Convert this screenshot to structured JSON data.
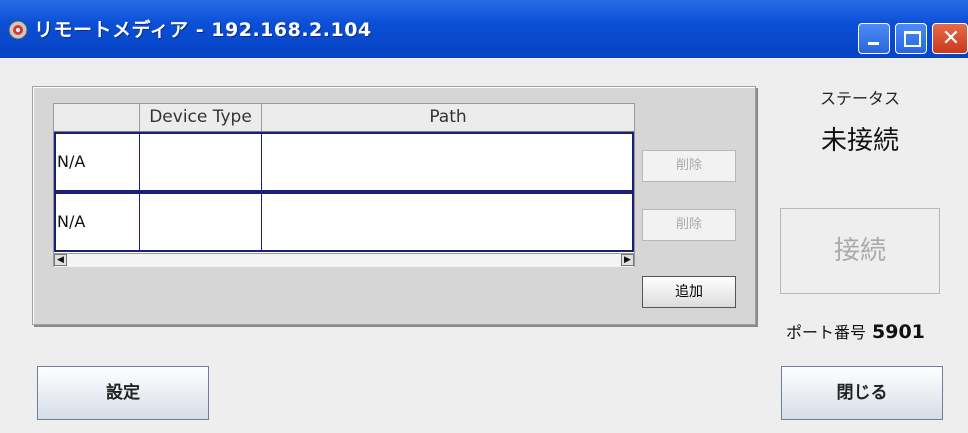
{
  "window": {
    "title": "リモートメディア - 192.168.2.104",
    "app_icon": "remote-media-app-icon",
    "controls": {
      "minimize": "minimize-icon",
      "maximize": "maximize-icon",
      "close_glyph": "✕"
    }
  },
  "table": {
    "columns": [
      "",
      "Device Type",
      "Path"
    ],
    "rows": [
      {
        "id": "N/A",
        "device_type": "",
        "path": "",
        "delete_label": "削除"
      },
      {
        "id": "N/A",
        "device_type": "",
        "path": "",
        "delete_label": "削除"
      }
    ],
    "scroll_left_glyph": "◀",
    "scroll_right_glyph": "▶"
  },
  "add_label": "追加",
  "status": {
    "label": "ステータス",
    "value": "未接続"
  },
  "connect_label": "接続",
  "port": {
    "label": "ポート番号",
    "value": "5901"
  },
  "settings_label": "設定",
  "close_label": "閉じる",
  "colors": {
    "titlebar": "#0a4fd6",
    "row_border": "#1a1f7a",
    "disabled_text": "#aaaaaa"
  }
}
